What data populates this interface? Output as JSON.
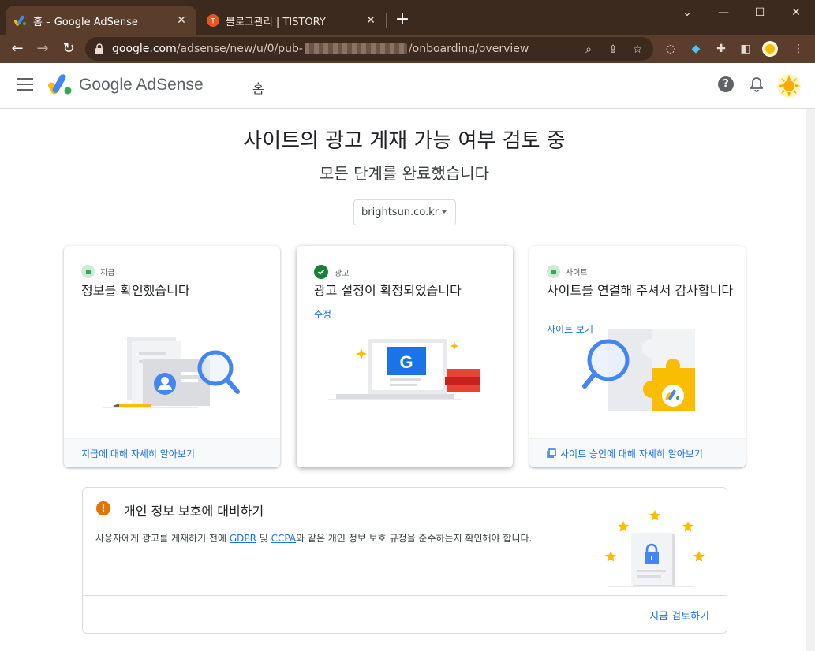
{
  "browser": {
    "tabs": [
      {
        "title": "홈 – Google AdSense",
        "active": true
      },
      {
        "title": "블로그관리 | TISTORY",
        "active": false
      }
    ],
    "url": {
      "host": "google.com",
      "path_start": "/adsense/new/u/0/pub-",
      "path_end": "/onboarding/overview"
    }
  },
  "app": {
    "brand": "Google AdSense",
    "breadcrumb": "홈"
  },
  "main": {
    "title": "사이트의 광고 게재 가능 여부 검토 중",
    "subtitle": "모든 단계를 완료했습니다",
    "site_selector": "brightsun.co.kr"
  },
  "cards": [
    {
      "step": "지급",
      "title": "정보를 확인했습니다",
      "link": "",
      "footer": "지급에 대해 자세히 알아보기"
    },
    {
      "step": "광고",
      "title": "광고 설정이 확정되었습니다",
      "link": "수정",
      "footer": ""
    },
    {
      "step": "사이트",
      "title": "사이트를 연결해 주셔서 감사합니다",
      "link": "사이트 보기",
      "footer": "사이트 승인에 대해 자세히 알아보기"
    }
  ],
  "privacy": {
    "title": "개인 정보 보호에 대비하기",
    "body_before": "사용자에게 광고를 게재하기 전에 ",
    "gdpr": "GDPR",
    "and": " 및 ",
    "ccpa": "CCPA",
    "body_after": "와 같은 개인 정보 보호 규정을 준수하는지 확인해야 합니다.",
    "action": "지금 검토하기"
  },
  "colors": {
    "chrome_frame": "#3c2a1e",
    "chrome_toolbar": "#5a3e2b",
    "link_blue": "#1a73e8",
    "success_green": "#188038",
    "warning_orange": "#e37400"
  }
}
